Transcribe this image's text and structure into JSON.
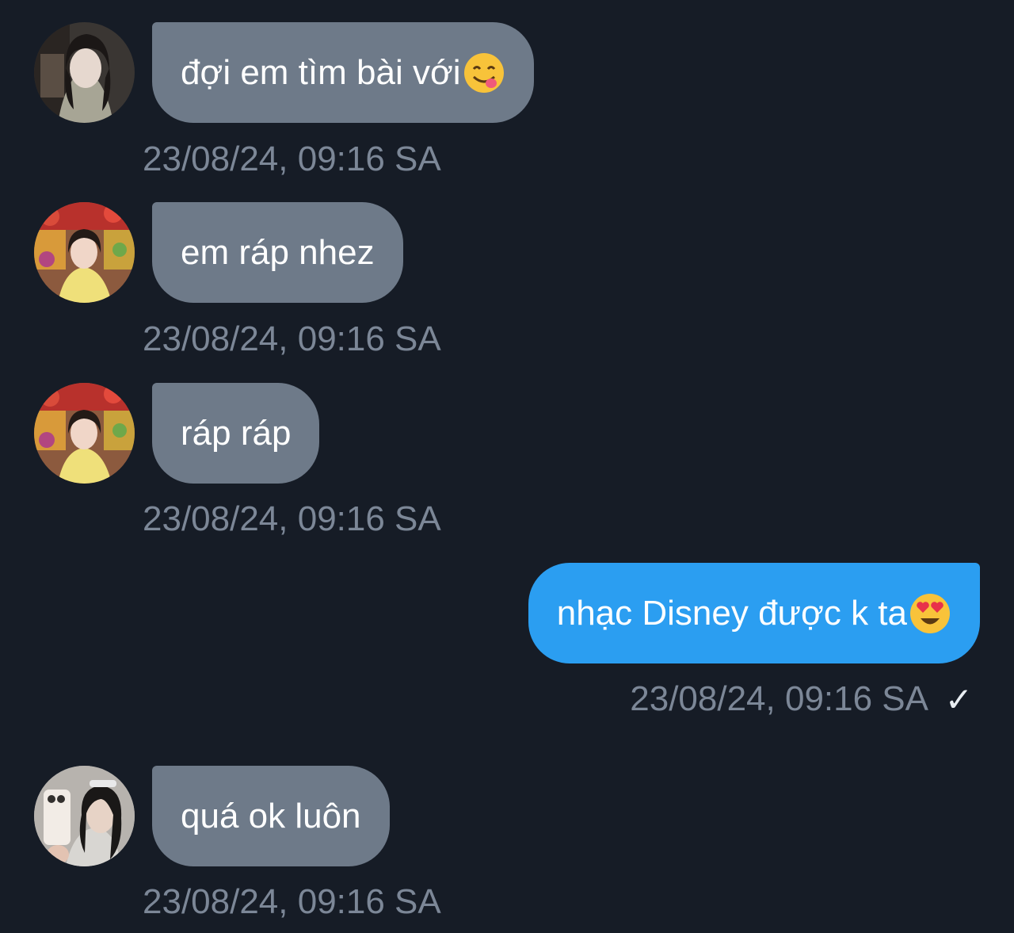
{
  "messages": [
    {
      "direction": "in",
      "avatar_icon": "avatar-dark-hair-icon",
      "text": "đợi em tìm bài với",
      "emoji_icon": "face-savoring-food-emoji-icon",
      "timestamp": "23/08/24, 09:16 SA"
    },
    {
      "direction": "in",
      "avatar_icon": "avatar-yellow-top-icon",
      "text": "em ráp nhez",
      "timestamp": "23/08/24, 09:16 SA"
    },
    {
      "direction": "in",
      "avatar_icon": "avatar-yellow-top-icon",
      "text": "ráp ráp",
      "timestamp": "23/08/24, 09:16 SA"
    },
    {
      "direction": "out",
      "text": "nhạc Disney được k ta",
      "emoji_icon": "heart-eyes-emoji-icon",
      "timestamp": "23/08/24, 09:16 SA",
      "status_icon": "checkmark-icon",
      "status_glyph": "✓"
    },
    {
      "direction": "in",
      "avatar_icon": "avatar-selfie-icon",
      "text": "quá ok luôn",
      "timestamp": "23/08/24, 09:16 SA"
    }
  ],
  "colors": {
    "background": "#161c26",
    "incoming_bubble": "#6e7a89",
    "outgoing_bubble": "#2b9ef1",
    "timestamp": "#7c8797"
  }
}
